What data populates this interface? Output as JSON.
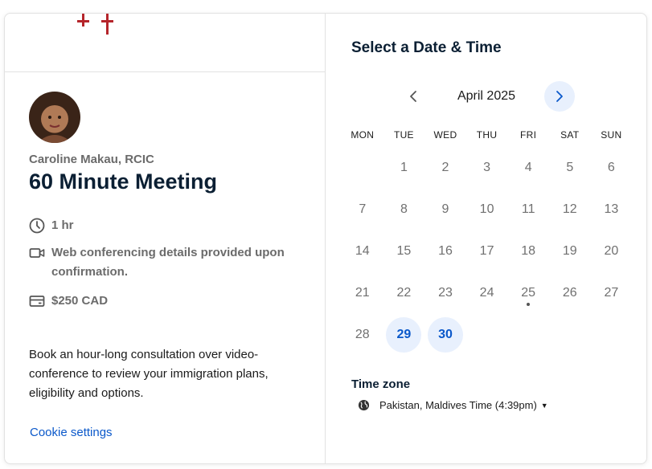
{
  "host": {
    "name": "Caroline Makau, RCIC"
  },
  "event": {
    "title": "60 Minute Meeting",
    "duration": "1 hr",
    "location": "Web conferencing details provided upon confirmation.",
    "price": "$250 CAD",
    "description": "Book an hour-long consultation over video-conference to review your immigration plans, eligibility and options."
  },
  "footer": {
    "cookie_link": "Cookie settings"
  },
  "scheduler": {
    "heading": "Select a Date & Time",
    "month_label": "April 2025",
    "weekdays": [
      "MON",
      "TUE",
      "WED",
      "THU",
      "FRI",
      "SAT",
      "SUN"
    ],
    "days": [
      {
        "n": "1",
        "available": false
      },
      {
        "n": "2",
        "available": false
      },
      {
        "n": "3",
        "available": false
      },
      {
        "n": "4",
        "available": false
      },
      {
        "n": "5",
        "available": false
      },
      {
        "n": "6",
        "available": false
      },
      {
        "n": "7",
        "available": false
      },
      {
        "n": "8",
        "available": false
      },
      {
        "n": "9",
        "available": false
      },
      {
        "n": "10",
        "available": false
      },
      {
        "n": "11",
        "available": false
      },
      {
        "n": "12",
        "available": false
      },
      {
        "n": "13",
        "available": false
      },
      {
        "n": "14",
        "available": false
      },
      {
        "n": "15",
        "available": false
      },
      {
        "n": "16",
        "available": false
      },
      {
        "n": "17",
        "available": false
      },
      {
        "n": "18",
        "available": false
      },
      {
        "n": "19",
        "available": false
      },
      {
        "n": "20",
        "available": false
      },
      {
        "n": "21",
        "available": false
      },
      {
        "n": "22",
        "available": false
      },
      {
        "n": "23",
        "available": false
      },
      {
        "n": "24",
        "available": false
      },
      {
        "n": "25",
        "available": false,
        "today": true
      },
      {
        "n": "26",
        "available": false
      },
      {
        "n": "27",
        "available": false
      },
      {
        "n": "28",
        "available": false
      },
      {
        "n": "29",
        "available": true
      },
      {
        "n": "30",
        "available": true
      }
    ],
    "first_weekday_offset": 1,
    "timezone_label": "Time zone",
    "timezone_value": "Pakistan, Maldives Time (4:39pm)"
  },
  "colors": {
    "accent": "#0a58ca",
    "accent_bg": "#e8f0fd",
    "heading": "#0b1f33",
    "muted": "#6b6b6b",
    "logo_red": "#b5252b"
  }
}
